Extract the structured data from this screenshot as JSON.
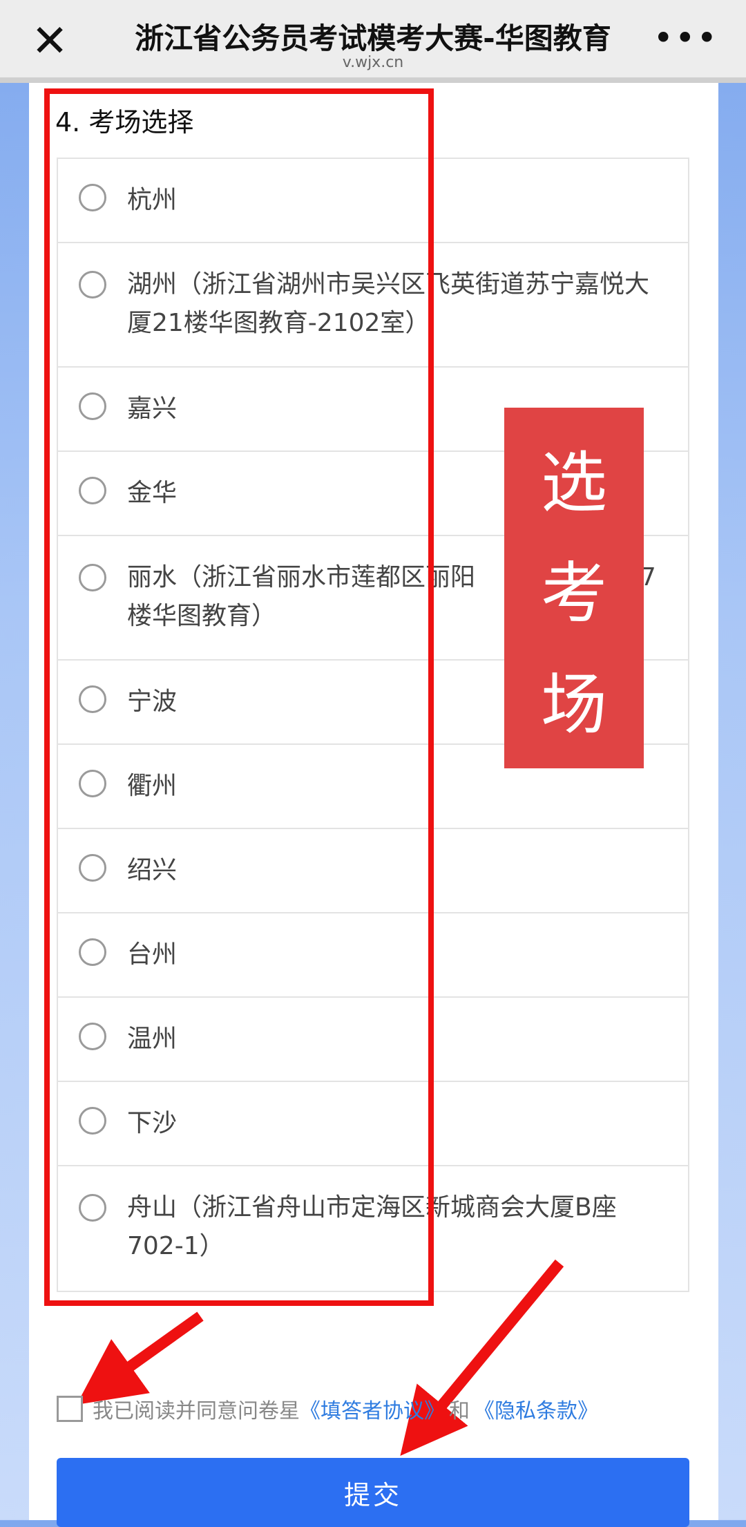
{
  "header": {
    "title": "浙江省公务员考试模考大赛-华图教育",
    "subtitle": "v.wjx.cn",
    "close_icon": "✕",
    "more_icon": "•••"
  },
  "question": {
    "title": "4. 考场选择",
    "options": [
      {
        "label": "杭州",
        "lines": 1
      },
      {
        "label": "湖州（浙江省湖州市吴兴区飞英街道苏宁嘉悦大厦21楼华图教育-2102室）",
        "lines": 2
      },
      {
        "label": "嘉兴",
        "lines": 1
      },
      {
        "label": "金华",
        "lines": 1
      },
      {
        "label": "丽水（浙江省丽水市莲都区丽阳 　　　 敞酒店7楼华图教育）",
        "lines": 2
      },
      {
        "label": "宁波",
        "lines": 1
      },
      {
        "label": "衢州",
        "lines": 1
      },
      {
        "label": "绍兴",
        "lines": 1
      },
      {
        "label": "台州",
        "lines": 1
      },
      {
        "label": "温州",
        "lines": 1
      },
      {
        "label": "下沙",
        "lines": 1
      },
      {
        "label": "舟山（浙江省舟山市定海区新城商会大厦B座702-1）",
        "lines": 2
      }
    ]
  },
  "annotation": {
    "chars": [
      "选",
      "考",
      "场"
    ],
    "color": "#e04444"
  },
  "agreement": {
    "prefix": "我已阅读并同意问卷星",
    "link1": "《填答者协议》",
    "middle": "和",
    "link2": "《隐私条款》"
  },
  "submit": {
    "label": "提交"
  },
  "colors": {
    "primary": "#2c6ff2",
    "annotation_red": "#ee1111",
    "link": "#2f7ce0"
  }
}
